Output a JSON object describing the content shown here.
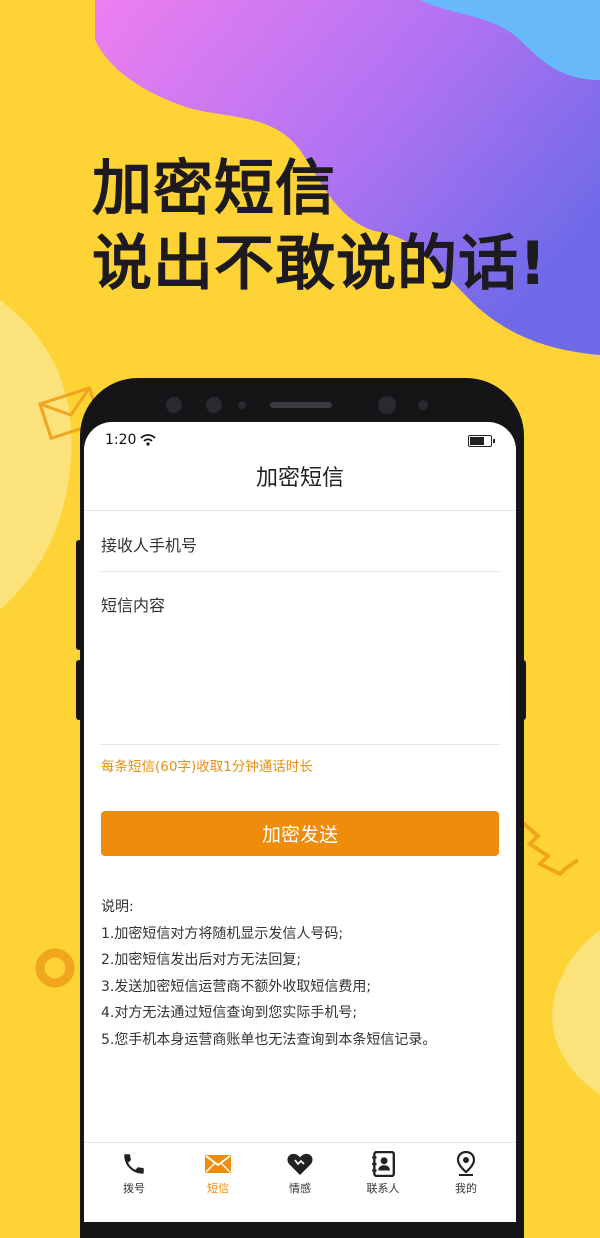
{
  "promo": {
    "headline_line1": "加密短信",
    "headline_line2": "说出不敢说的话!"
  },
  "status_bar": {
    "time": "1:20"
  },
  "app": {
    "title": "加密短信",
    "recipient_placeholder": "接收人手机号",
    "content_placeholder": "短信内容",
    "fee_tip": "每条短信(60字)收取1分钟通话时长",
    "send_button": "加密发送",
    "notes_title": "说明:",
    "notes": [
      "1.加密短信对方将随机显示发信人号码;",
      "2.加密短信发出后对方无法回复;",
      "3.发送加密短信运营商不额外收取短信费用;",
      "4.对方无法通过短信查询到您实际手机号;",
      "5.您手机本身运营商账单也无法查询到本条短信记录。"
    ]
  },
  "tabbar": {
    "items": [
      {
        "label": "拨号",
        "icon": "phone-icon"
      },
      {
        "label": "短信",
        "icon": "envelope-icon",
        "active": true
      },
      {
        "label": "情感",
        "icon": "heart-icon"
      },
      {
        "label": "联系人",
        "icon": "contacts-icon"
      },
      {
        "label": "我的",
        "icon": "location-pin-icon"
      }
    ]
  },
  "colors": {
    "background_yellow": "#fdd335",
    "accent_orange": "#ef8c0b",
    "tip_orange": "#e6900f",
    "headline_text": "#1d1b1f"
  }
}
